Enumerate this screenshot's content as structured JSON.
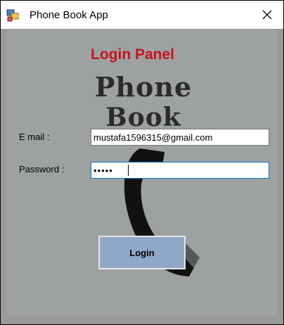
{
  "window": {
    "title": "Phone Book App",
    "icons": {
      "app": "app-window-icon",
      "close": "close-icon"
    }
  },
  "form": {
    "heading": "Login Panel",
    "logo_line1": "Phone",
    "logo_line2": "Book",
    "email_label": "E mail :",
    "email_value": "mustafa1596315@gmail.com",
    "password_label": "Password :",
    "password_value": "•••••",
    "login_label": "Login"
  },
  "colors": {
    "client_bg": "#9ea1a1",
    "heading": "#c8141c",
    "button_bg": "#8fa7c8",
    "focus_border": "#0078d7"
  }
}
